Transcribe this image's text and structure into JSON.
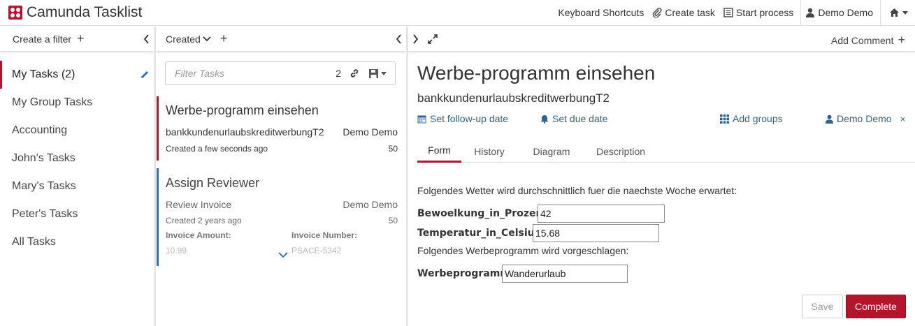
{
  "app": {
    "title": "Camunda Tasklist"
  },
  "nav": {
    "keyboard_shortcuts": "Keyboard Shortcuts",
    "create_task": "Create task",
    "start_process": "Start process",
    "user": "Demo Demo"
  },
  "filters": {
    "create_label": "Create a filter",
    "items": [
      {
        "name": "My Tasks",
        "count": "(2)"
      },
      {
        "name": "My Group Tasks"
      },
      {
        "name": "Accounting"
      },
      {
        "name": "John's Tasks"
      },
      {
        "name": "Mary's Tasks"
      },
      {
        "name": "Peter's Tasks"
      },
      {
        "name": "All Tasks"
      }
    ]
  },
  "list": {
    "sort_label": "Created",
    "search_placeholder": "Filter Tasks",
    "search_count": "2",
    "tasks": [
      {
        "title": "Werbe-programm einsehen",
        "process": "bankkundenurlaubskreditwerbungT2",
        "assignee": "Demo Demo",
        "created": "Created a few seconds ago",
        "priority": "50"
      },
      {
        "title": "Assign Reviewer",
        "process": "Review Invoice",
        "assignee": "Demo Demo",
        "created": "Created 2 years ago",
        "priority": "50",
        "vars": [
          {
            "label": "Invoice Amount:",
            "value": "10.99"
          },
          {
            "label": "Invoice Number:",
            "value": "PSACE-5342"
          }
        ]
      }
    ]
  },
  "detail": {
    "add_comment": "Add Comment",
    "title": "Werbe-programm einsehen",
    "subtitle": "bankkundenurlaubskreditwerbungT2",
    "follow_up": "Set follow-up date",
    "due_date": "Set due date",
    "add_groups": "Add groups",
    "assignee": "Demo Demo",
    "tabs": [
      "Form",
      "History",
      "Diagram",
      "Description"
    ],
    "form": {
      "intro": "Folgendes Wetter wird durchschnittlich fuer die naechste Woche erwartet:",
      "field1_label": "Bewoelkung_in_Prozent",
      "field1_value": "42",
      "field2_label": "Temperatur_in_Celsius",
      "field2_value": "15.68",
      "intro2": "Folgendes Werbeprogramm wird vorgeschlagen:",
      "field3_label": "Werbeprogramm",
      "field3_value": "Wanderurlaub",
      "save": "Save",
      "complete": "Complete"
    }
  },
  "colors": {
    "brand": "#b5152b",
    "link": "#2a6496",
    "accent_blue": "#2a6cbf"
  }
}
